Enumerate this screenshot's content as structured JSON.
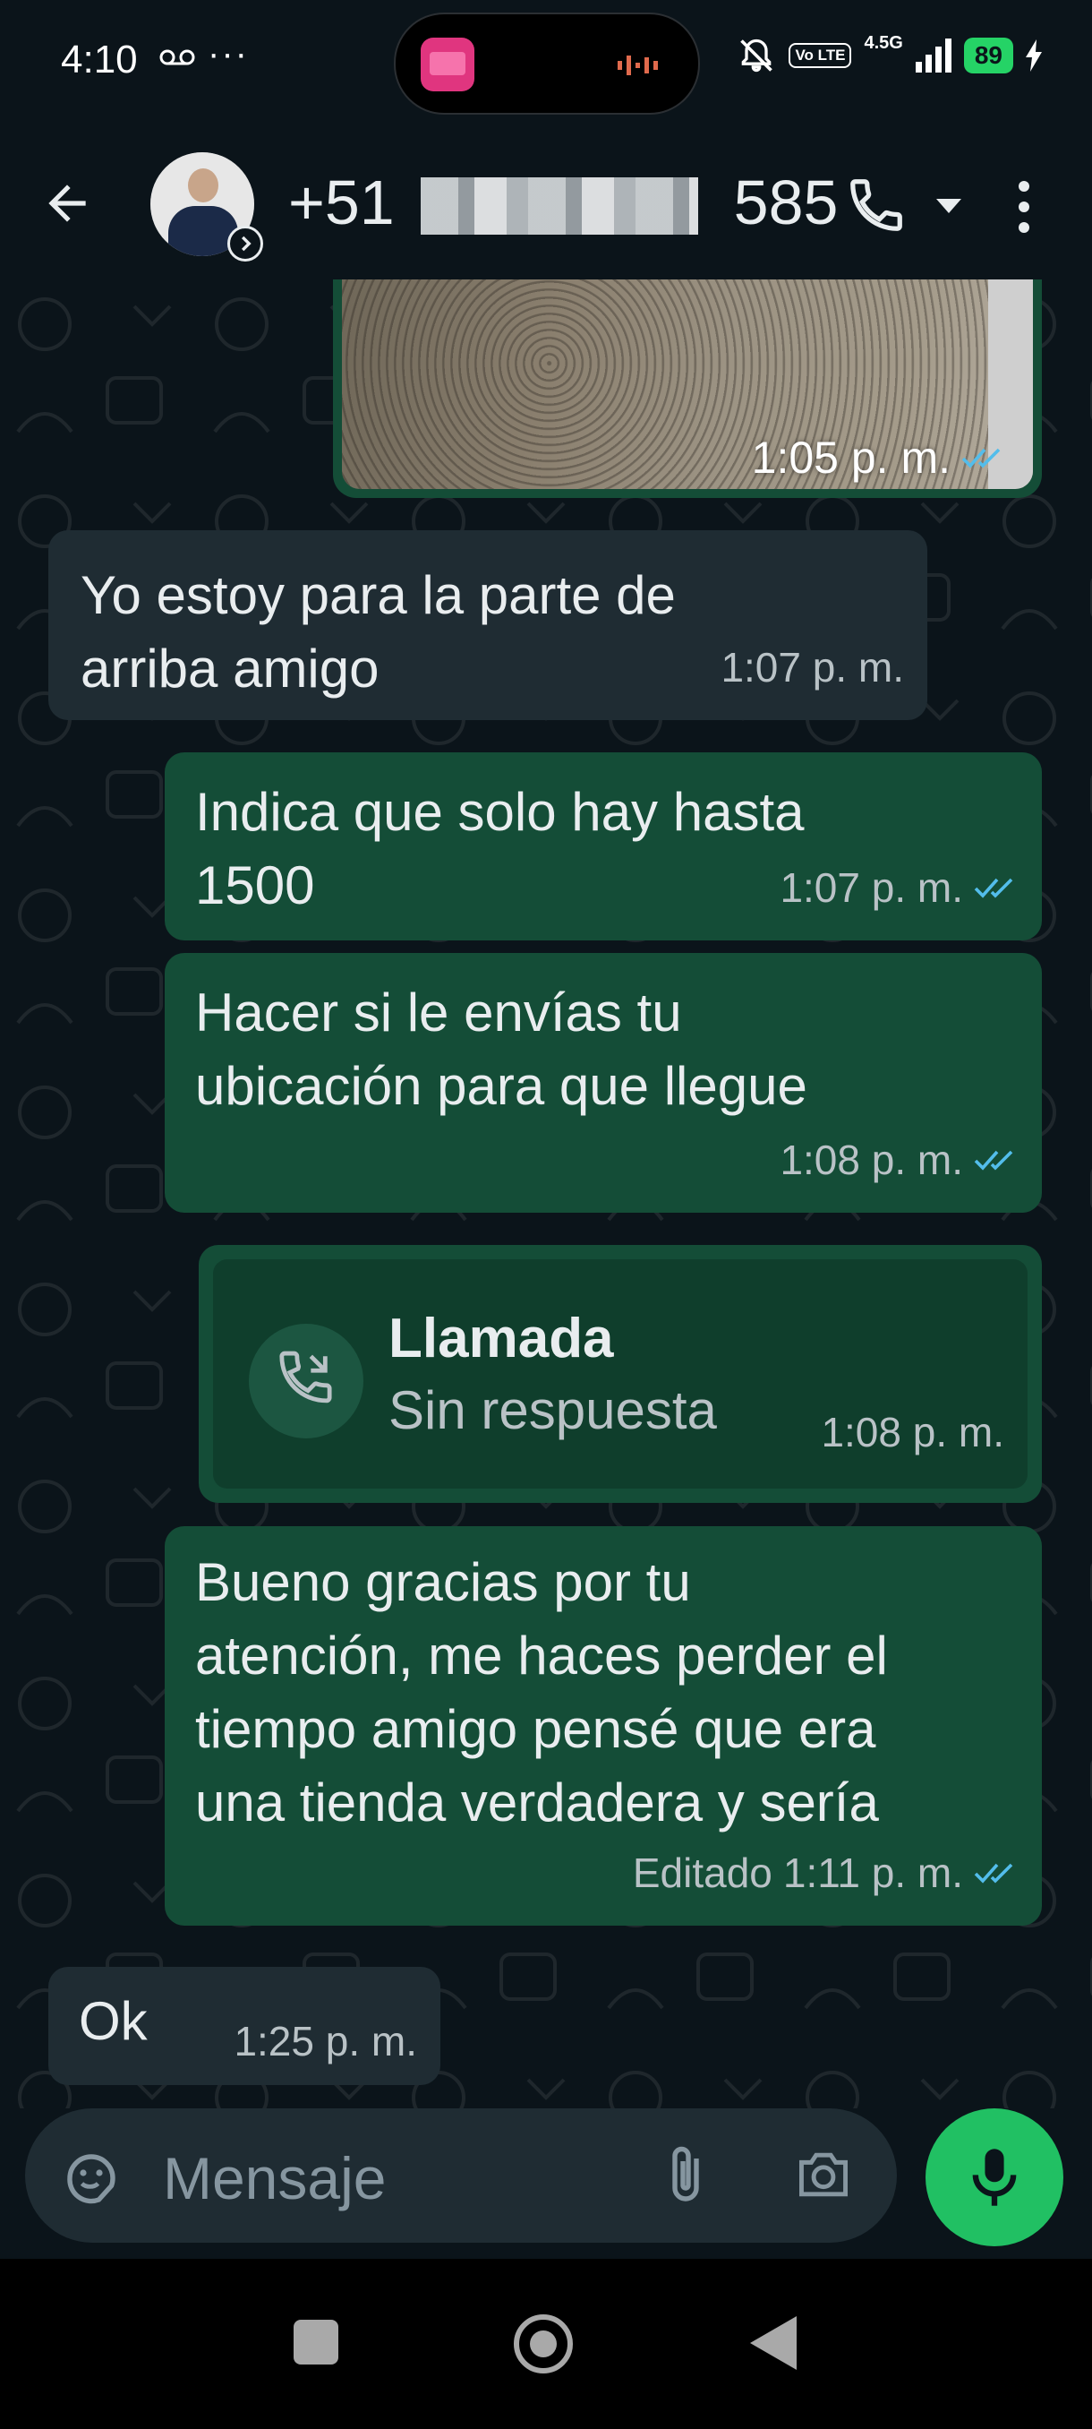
{
  "status_bar": {
    "time": "4:10",
    "dots": "···",
    "volte": "Vo LTE",
    "network": "4.5G",
    "battery": "89"
  },
  "header": {
    "contact_prefix": "+51",
    "contact_suffix": "585"
  },
  "messages": [
    {
      "id": "image",
      "direction": "out",
      "time": "1:05 p. m.",
      "status": "read"
    },
    {
      "id": "m1",
      "direction": "in",
      "text": [
        "Yo estoy para la parte de",
        "arriba amigo"
      ],
      "time": "1:07 p. m."
    },
    {
      "id": "m2",
      "direction": "out",
      "text": [
        "Indica que solo hay hasta",
        "1500"
      ],
      "time": "1:07 p. m.",
      "status": "read"
    },
    {
      "id": "m3",
      "direction": "out",
      "text": [
        "Hacer si le envías tu",
        "ubicación para que llegue"
      ],
      "time": "1:08 p. m.",
      "status": "read"
    },
    {
      "id": "call",
      "direction": "out",
      "title": "Llamada",
      "subtitle": "Sin respuesta",
      "time": "1:08 p. m."
    },
    {
      "id": "m4",
      "direction": "out",
      "text": [
        "Bueno gracias por tu",
        "atención, me haces perder el",
        "tiempo amigo pensé que era",
        "una tienda verdadera y sería"
      ],
      "edited_label": "Editado",
      "time": "1:11 p. m.",
      "status": "read"
    },
    {
      "id": "m5",
      "direction": "in",
      "text": [
        "Ok"
      ],
      "time": "1:25 p. m."
    }
  ],
  "input": {
    "placeholder": "Mensaje"
  },
  "colors": {
    "background": "#0b141a",
    "incoming": "#1f2c33",
    "outgoing": "#144d37",
    "accent": "#21c063",
    "ticks": "#53bdeb"
  },
  "icons": [
    "back-arrow-icon",
    "phone-icon",
    "caret-down-icon",
    "more-vert-icon",
    "sticker-icon",
    "attach-icon",
    "camera-icon",
    "mic-icon",
    "missed-call-icon"
  ]
}
